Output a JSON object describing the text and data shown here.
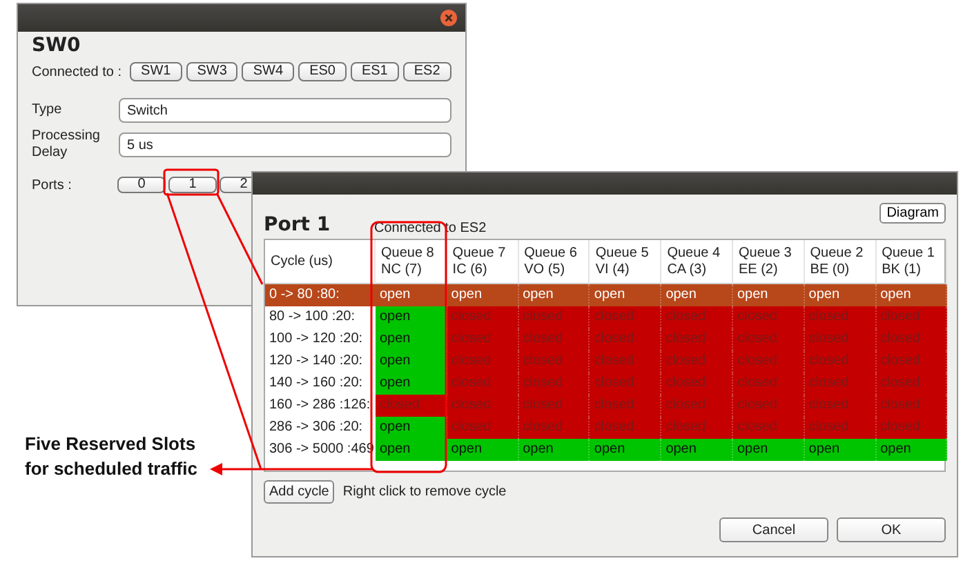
{
  "node_window": {
    "title": "SW0",
    "connected_label": "Connected to :",
    "connections": [
      "SW1",
      "SW3",
      "SW4",
      "ES0",
      "ES1",
      "ES2"
    ],
    "fields": [
      {
        "label": "Type",
        "value": "Switch"
      },
      {
        "label": "Processing Delay",
        "value": "5 us"
      }
    ],
    "ports_label": "Ports :",
    "ports": [
      "0",
      "1",
      "2"
    ]
  },
  "port_window": {
    "title": "Port 1",
    "connected_to": "Connected to ES2",
    "diagram_button": "Diagram",
    "table": {
      "cycle_header": "Cycle (us)",
      "columns": [
        {
          "lines": [
            "Queue 8",
            "NC (7)"
          ]
        },
        {
          "lines": [
            "Queue 7",
            "IC (6)"
          ]
        },
        {
          "lines": [
            "Queue 6",
            "VO (5)"
          ]
        },
        {
          "lines": [
            "Queue 5",
            "VI (4)"
          ]
        },
        {
          "lines": [
            "Queue 4",
            "CA (3)"
          ]
        },
        {
          "lines": [
            "Queue 3",
            "EE (2)"
          ]
        },
        {
          "lines": [
            "Queue 2",
            "BE (0)"
          ]
        },
        {
          "lines": [
            "Queue 1",
            "BK (1)"
          ]
        }
      ],
      "rows": [
        {
          "cycle": "0 -> 80 :80:",
          "selected": true,
          "cells": [
            {
              "text": "open",
              "open": true
            },
            {
              "text": "open",
              "open": true
            },
            {
              "text": "open",
              "open": true
            },
            {
              "text": "open",
              "open": true
            },
            {
              "text": "open",
              "open": true
            },
            {
              "text": "open",
              "open": true
            },
            {
              "text": "open",
              "open": true
            },
            {
              "text": "open",
              "open": true
            }
          ]
        },
        {
          "cycle": "80 -> 100 :20:",
          "selected": false,
          "cells": [
            {
              "text": "open",
              "open": true
            },
            {
              "text": "closed",
              "open": false
            },
            {
              "text": "closed",
              "open": false
            },
            {
              "text": "closed",
              "open": false
            },
            {
              "text": "closed",
              "open": false
            },
            {
              "text": "closed",
              "open": false
            },
            {
              "text": "closed",
              "open": false
            },
            {
              "text": "closed",
              "open": false
            }
          ]
        },
        {
          "cycle": "100 -> 120 :20:",
          "selected": false,
          "cells": [
            {
              "text": "open",
              "open": true
            },
            {
              "text": "closed",
              "open": false
            },
            {
              "text": "closed",
              "open": false
            },
            {
              "text": "closed",
              "open": false
            },
            {
              "text": "closed",
              "open": false
            },
            {
              "text": "closed",
              "open": false
            },
            {
              "text": "closed",
              "open": false
            },
            {
              "text": "closed",
              "open": false
            }
          ]
        },
        {
          "cycle": "120 -> 140 :20:",
          "selected": false,
          "cells": [
            {
              "text": "open",
              "open": true
            },
            {
              "text": "closed",
              "open": false
            },
            {
              "text": "closed",
              "open": false
            },
            {
              "text": "closed",
              "open": false
            },
            {
              "text": "closed",
              "open": false
            },
            {
              "text": "closed",
              "open": false
            },
            {
              "text": "closed",
              "open": false
            },
            {
              "text": "closed",
              "open": false
            }
          ]
        },
        {
          "cycle": "140 -> 160 :20:",
          "selected": false,
          "cells": [
            {
              "text": "open",
              "open": true
            },
            {
              "text": "closed",
              "open": false
            },
            {
              "text": "closed",
              "open": false
            },
            {
              "text": "closed",
              "open": false
            },
            {
              "text": "closed",
              "open": false
            },
            {
              "text": "closed",
              "open": false
            },
            {
              "text": "closed",
              "open": false
            },
            {
              "text": "closed",
              "open": false
            }
          ]
        },
        {
          "cycle": "160 -> 286 :126:",
          "selected": false,
          "cells": [
            {
              "text": "closed",
              "open": false
            },
            {
              "text": "closed",
              "open": false
            },
            {
              "text": "closed",
              "open": false
            },
            {
              "text": "closed",
              "open": false
            },
            {
              "text": "closed",
              "open": false
            },
            {
              "text": "closed",
              "open": false
            },
            {
              "text": "closed",
              "open": false
            },
            {
              "text": "closed",
              "open": false
            }
          ]
        },
        {
          "cycle": "286 -> 306 :20:",
          "selected": false,
          "cells": [
            {
              "text": "open",
              "open": true
            },
            {
              "text": "closed",
              "open": false
            },
            {
              "text": "closed",
              "open": false
            },
            {
              "text": "closed",
              "open": false
            },
            {
              "text": "closed",
              "open": false
            },
            {
              "text": "closed",
              "open": false
            },
            {
              "text": "closed",
              "open": false
            },
            {
              "text": "closed",
              "open": false
            }
          ]
        },
        {
          "cycle": "306 -> 5000 :469",
          "selected": false,
          "cells": [
            {
              "text": "open",
              "open": true
            },
            {
              "text": "open",
              "open": true
            },
            {
              "text": "open",
              "open": true
            },
            {
              "text": "open",
              "open": true
            },
            {
              "text": "open",
              "open": true
            },
            {
              "text": "open",
              "open": true
            },
            {
              "text": "open",
              "open": true
            },
            {
              "text": "open",
              "open": true
            }
          ]
        }
      ]
    },
    "add_button": "Add cycle",
    "hint": "Right click to remove cycle",
    "buttons": [
      "Cancel",
      "OK"
    ]
  },
  "annotation": {
    "text": "Five Reserved Slots for scheduled traffic"
  }
}
